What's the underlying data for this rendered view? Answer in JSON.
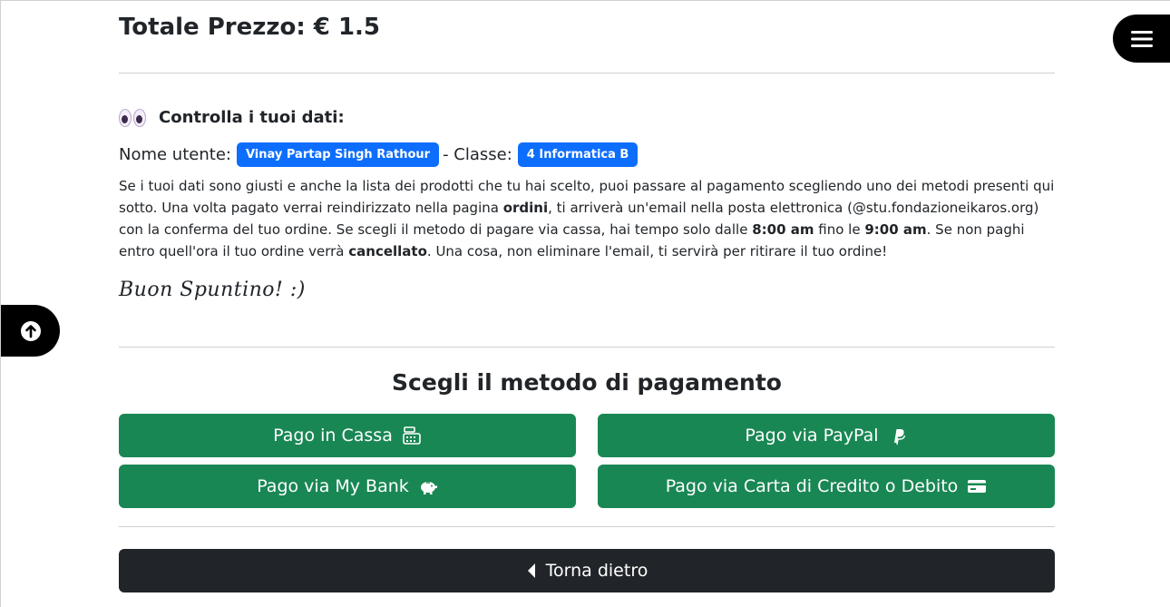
{
  "total_label": "Totale Prezzo: € 1.5",
  "check": {
    "title": "Controlla i tuoi dati:",
    "icon": "eyes-icon"
  },
  "user": {
    "name_label": "Nome utente:",
    "name": "Vinay Partap Singh Rathour",
    "class_label": "- Classe:",
    "class": "4 Informatica B"
  },
  "description": {
    "p1": "Se i tuoi dati sono giusti e anche la lista dei prodotti che tu hai scelto, puoi passare al pagamento scegliendo uno dei metodi presenti qui sotto. Una volta pagato verrai reindirizzato nella pagina ",
    "b1": "ordini",
    "p2": ", ti arriverà un'email nella posta elettronica (@stu.fondazioneikaros.org) con la conferma del tuo ordine. Se scegli il metodo di pagare via cassa, hai tempo solo dalle ",
    "b2": "8:00 am",
    "p3": " fino le ",
    "b3": "9:00 am",
    "p4": ". Se non paghi entro quell'ora il tuo ordine verrà ",
    "b4": "cancellato",
    "p5": ". Una cosa, non eliminare l'email, ti servirà per ritirare il tuo ordine!"
  },
  "greeting": "Buon Spuntino! :)",
  "payment": {
    "heading": "Scegli il metodo di pagamento",
    "cassa": "Pago in Cassa",
    "paypal": "Pago via PayPal",
    "mybank": "Pago via My Bank",
    "carta": "Pago via Carta di Credito o Debito"
  },
  "back_label": "Torna dietro",
  "colors": {
    "primary": "#0d6efd",
    "success": "#198754",
    "dark": "#212529"
  }
}
